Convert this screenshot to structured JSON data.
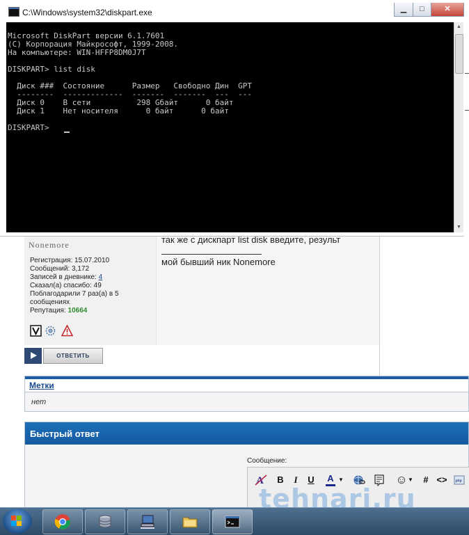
{
  "cmd_window": {
    "title": "C:\\Windows\\system32\\diskpart.exe",
    "caption_buttons": {
      "minimize": "▁",
      "maximize": "□",
      "close": "✕"
    },
    "console_lines": [
      "Microsoft DiskPart версии 6.1.7601",
      "(C) Корпорация Майкрософт, 1999-2008.",
      "На компьютере: WIN-HFFP8DM0J7T",
      "",
      "DISKPART> list disk",
      "",
      "  Диск ###  Состояние      Размер   Свободно Дин  GPT",
      "  --------  -------------  -------  -------  ---  ---",
      "  Диск 0    В сети          298 Gбайт      0 байт",
      "  Диск 1    Нет носителя      0 байт      0 байт",
      "",
      "DISKPART> "
    ]
  },
  "post": {
    "nickname": "Nonemore",
    "stats": [
      "Регистрация: 15.07.2010",
      "Сообщений: 3,172",
      "Записей в дневнике: ",
      "Сказал(а) спасибо: 49",
      "Поблагодарили 7 раз(а) в 5",
      "сообщениях",
      "Репутация: "
    ],
    "diary_count": "4",
    "reputation": "10664",
    "text": "так же с дискпарт list disk введите, результ",
    "signature": "мой бывший ник Nonemore",
    "user_icons": [
      "v-badge-icon",
      "gear-spin-icon",
      "warning-icon"
    ]
  },
  "reply_button": {
    "label": "ОТВЕТИТЬ"
  },
  "tags": {
    "title": "Метки",
    "value": "нет"
  },
  "quick_reply": {
    "title": "Быстрый ответ",
    "message_label": "Сообщение:",
    "toolbar": [
      "remove-format-icon",
      "B",
      "I",
      "U",
      "A",
      "link-icon",
      "quote-icon",
      "smiley-icon",
      "#",
      "<>",
      "php-icon"
    ]
  },
  "watermark": "tehnari.ru",
  "taskbar": {
    "items": [
      "start-orb",
      "chrome-icon",
      "database-icon",
      "network-pc-icon",
      "folder-icon",
      "cmd-icon"
    ]
  },
  "colors": {
    "console_bg": "#000000",
    "console_text": "#c8c8c8",
    "forum_blue": "#1559a0",
    "reputation_green": "#2e8b2e",
    "taskbar": "#3a5a78"
  }
}
